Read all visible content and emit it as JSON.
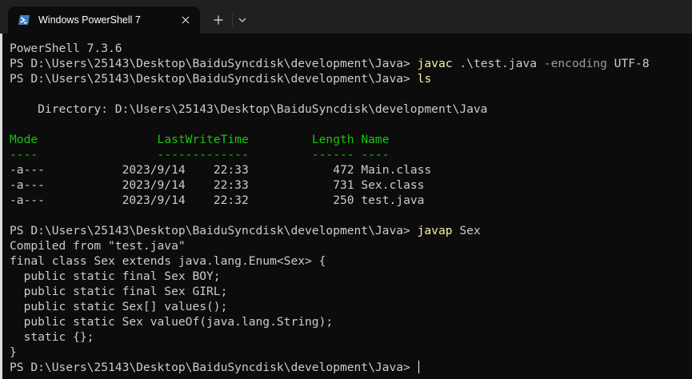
{
  "window": {
    "tab_title": "Windows PowerShell 7",
    "tab_icon": "powershell-icon",
    "close_icon": "close-icon",
    "new_tab_icon": "plus-icon",
    "dropdown_icon": "chevron-down-icon"
  },
  "terminal": {
    "version_line": "PowerShell 7.3.6",
    "prompt": "PS D:\\Users\\25143\\Desktop\\BaiduSyncdisk\\development\\Java>",
    "cmd1": {
      "command": "javac",
      "arg1": ".\\test.java",
      "option": "-encoding",
      "arg2": "UTF-8"
    },
    "cmd2": {
      "command": "ls"
    },
    "directory_line": "    Directory: D:\\Users\\25143\\Desktop\\BaiduSyncdisk\\development\\Java",
    "listing": {
      "headers": [
        "Mode",
        "LastWriteTime",
        "Length",
        "Name"
      ],
      "underlines": [
        "----",
        "-------------",
        "------",
        "----"
      ],
      "rows": [
        {
          "mode": "-a---",
          "date": "2023/9/14",
          "time": "22:33",
          "length": "472",
          "name": "Main.class"
        },
        {
          "mode": "-a---",
          "date": "2023/9/14",
          "time": "22:33",
          "length": "731",
          "name": "Sex.class"
        },
        {
          "mode": "-a---",
          "date": "2023/9/14",
          "time": "22:32",
          "length": "250",
          "name": "test.java"
        }
      ]
    },
    "cmd3": {
      "command": "javap",
      "arg": "Sex"
    },
    "javap_output": [
      "Compiled from \"test.java\"",
      "final class Sex extends java.lang.Enum<Sex> {",
      "  public static final Sex BOY;",
      "  public static final Sex GIRL;",
      "  public static Sex[] values();",
      "  public static Sex valueOf(java.lang.String);",
      "  static {};",
      "}"
    ]
  },
  "colors": {
    "background": "#0c0c0c",
    "titlebar": "#202020",
    "text": "#cccccc",
    "command": "#f9f1a5",
    "header": "#16c60c",
    "option": "#9d9d9d"
  }
}
